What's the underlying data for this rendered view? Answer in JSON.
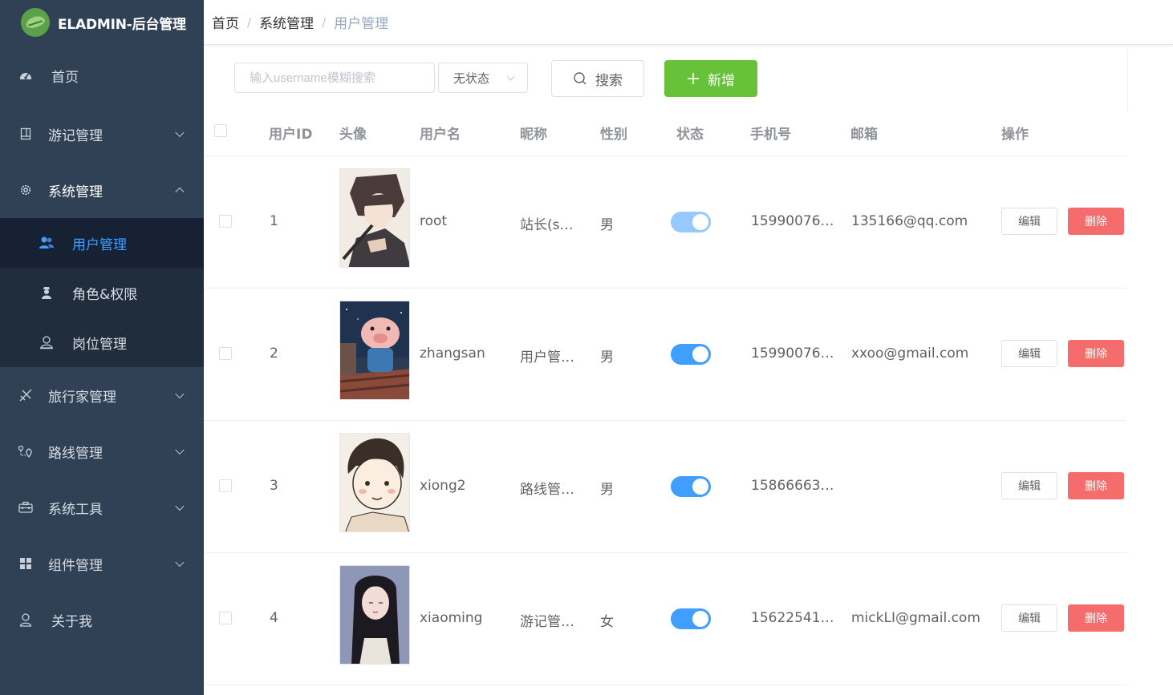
{
  "app": {
    "title": "ELADMIN-后台管理"
  },
  "sidebar": {
    "items": [
      {
        "label": "首页",
        "icon": "dashboard-icon"
      },
      {
        "label": "游记管理",
        "icon": "notebook-icon"
      },
      {
        "label": "系统管理",
        "icon": "gear-icon"
      },
      {
        "label": "旅行家管理",
        "icon": "travel-icon"
      },
      {
        "label": "路线管理",
        "icon": "route-icon"
      },
      {
        "label": "系统工具",
        "icon": "toolbox-icon"
      },
      {
        "label": "组件管理",
        "icon": "grid-icon"
      },
      {
        "label": "关于我",
        "icon": "user-icon"
      }
    ],
    "sub_items": [
      {
        "label": "用户管理",
        "icon": "users-icon"
      },
      {
        "label": "角色&权限",
        "icon": "role-icon"
      },
      {
        "label": "岗位管理",
        "icon": "post-icon"
      }
    ]
  },
  "breadcrumb": {
    "items": [
      "首页",
      "系统管理",
      "用户管理"
    ],
    "sep": "/"
  },
  "toolbar": {
    "search_placeholder": "输入username模糊搜索",
    "status_value": "无状态",
    "search_label": "搜索",
    "add_label": "新增"
  },
  "table": {
    "columns": [
      "用户ID",
      "头像",
      "用户名",
      "昵称",
      "性别",
      "状态",
      "手机号",
      "邮箱",
      "操作"
    ],
    "edit_label": "编辑",
    "delete_label": "删除",
    "rows": [
      {
        "id": "1",
        "username": "root",
        "nickname": "站长(s…",
        "gender": "男",
        "enabled": true,
        "phone": "15990076…",
        "email": "135166@qq.com"
      },
      {
        "id": "2",
        "username": "zhangsan",
        "nickname": "用户管…",
        "gender": "男",
        "enabled": true,
        "phone": "15990076…",
        "email": "xxoo@gmail.com"
      },
      {
        "id": "3",
        "username": "xiong2",
        "nickname": "路线管…",
        "gender": "男",
        "enabled": true,
        "phone": "15866663…",
        "email": ""
      },
      {
        "id": "4",
        "username": "xiaoming",
        "nickname": "游记管…",
        "gender": "女",
        "enabled": true,
        "phone": "15622541…",
        "email": "mickLI@gmail.com"
      }
    ]
  },
  "colors": {
    "sidebar_bg": "#304156",
    "submenu_bg": "#1f2d3d",
    "primary": "#409eff",
    "success": "#67c23a",
    "danger": "#f56c6c"
  }
}
